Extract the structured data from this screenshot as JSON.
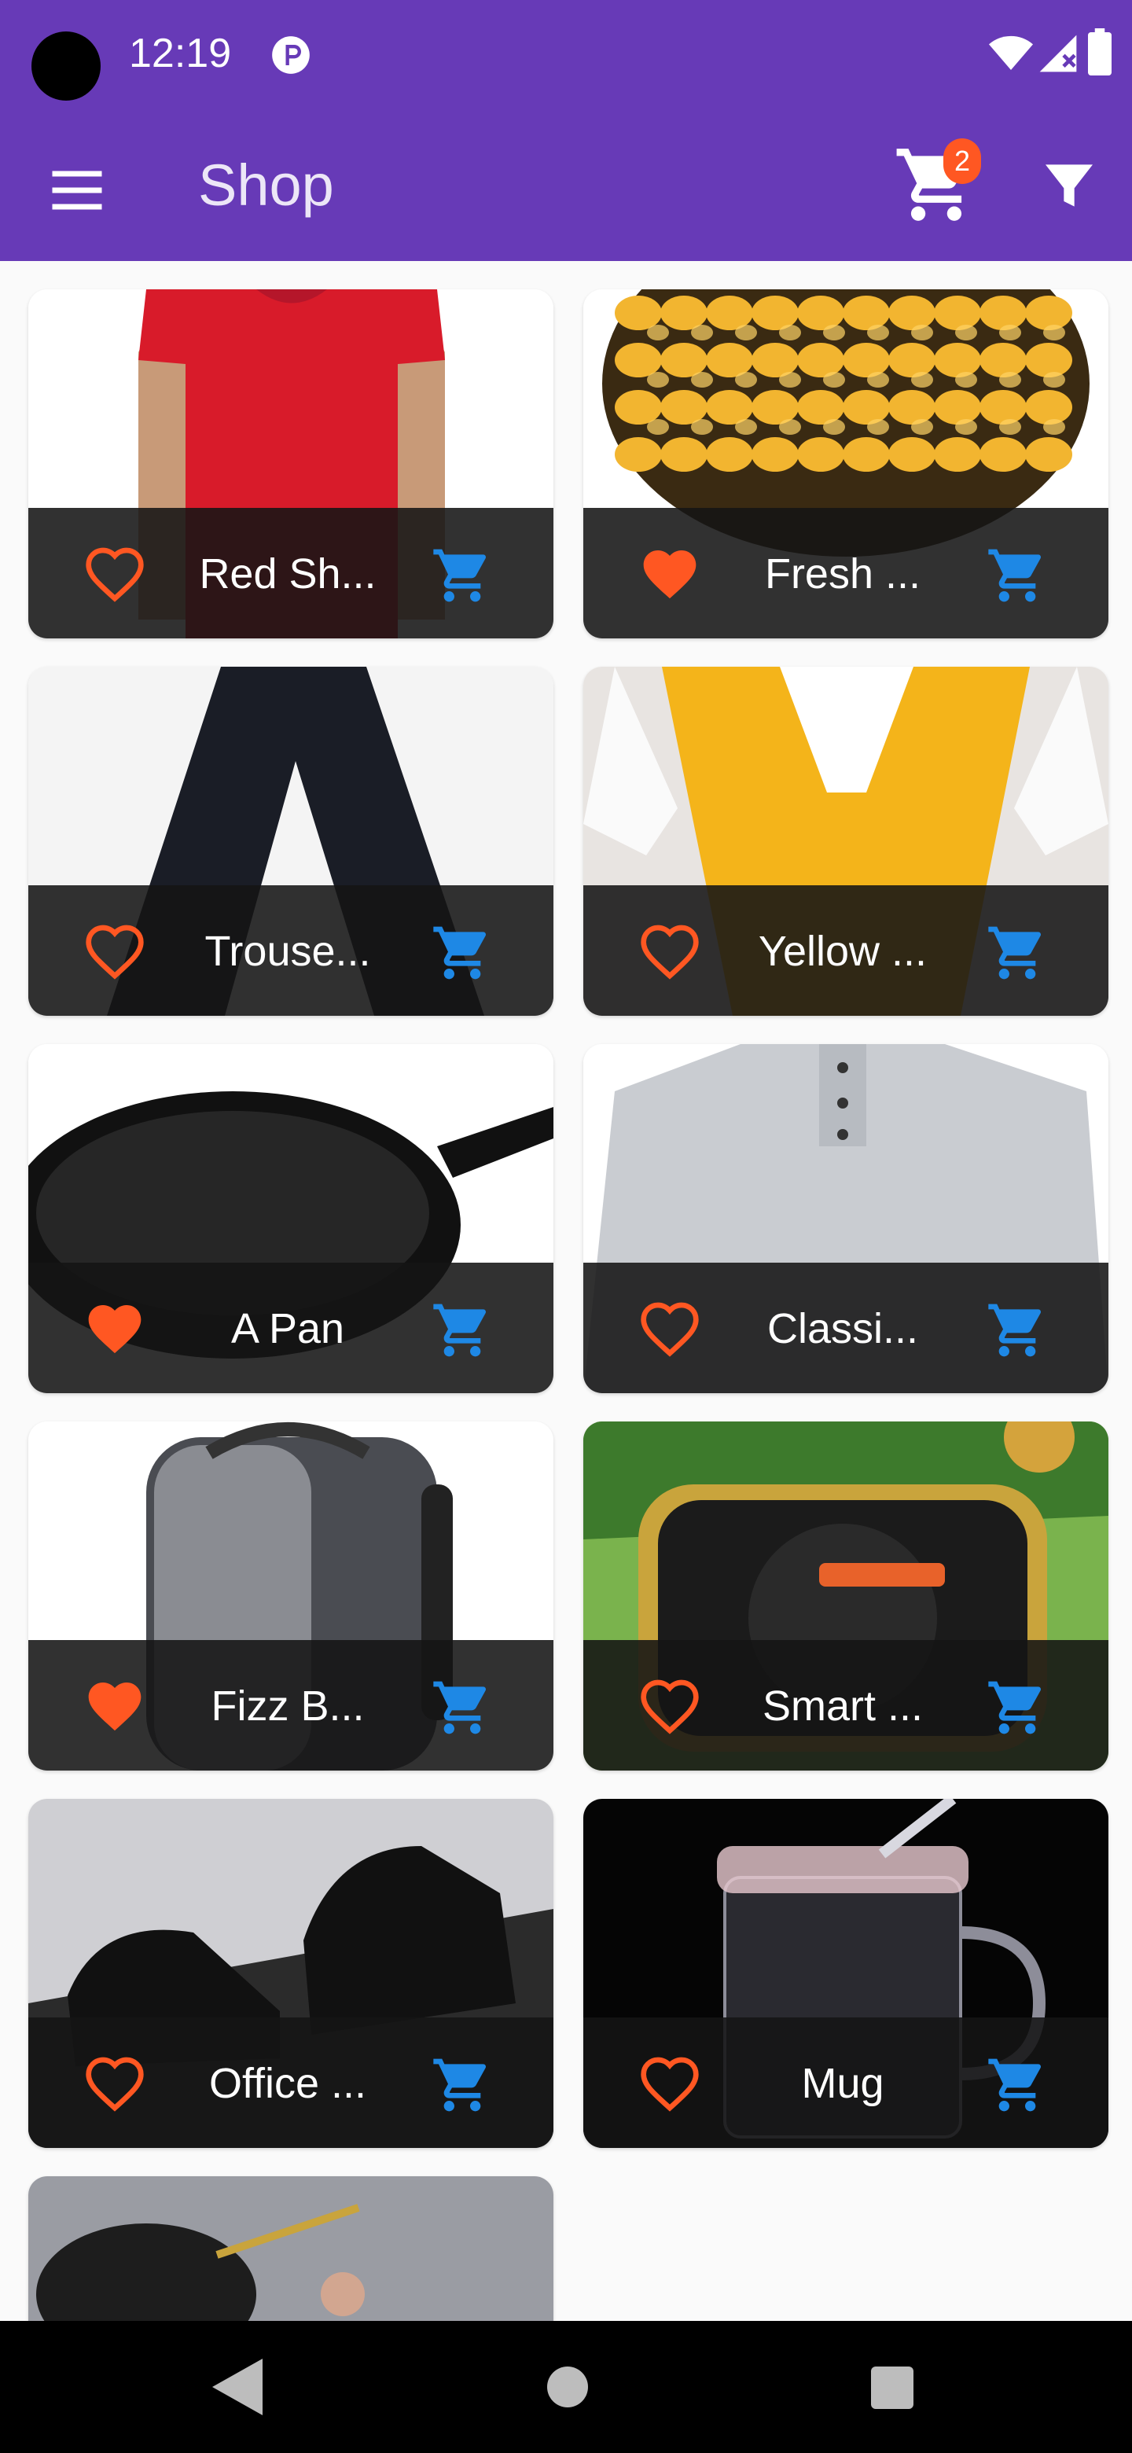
{
  "status_bar": {
    "time": "12:19"
  },
  "app_bar": {
    "title": "Shop",
    "cart_count": "2"
  },
  "colors": {
    "primary": "#673ab7",
    "accent": "#ff5722",
    "cart_icon": "#1e88e5"
  },
  "products": [
    {
      "name": "Red Sh...",
      "favorite": false,
      "image": "red-shirt"
    },
    {
      "name": "Fresh ...",
      "favorite": true,
      "image": "raisins"
    },
    {
      "name": "Trouse...",
      "favorite": false,
      "image": "trousers"
    },
    {
      "name": "Yellow ...",
      "favorite": false,
      "image": "yellow-scarf"
    },
    {
      "name": "A Pan",
      "favorite": true,
      "image": "pan"
    },
    {
      "name": "Classi...",
      "favorite": false,
      "image": "grey-shirt"
    },
    {
      "name": "Fizz B...",
      "favorite": true,
      "image": "backpack"
    },
    {
      "name": "Smart ...",
      "favorite": false,
      "image": "smart-watch"
    },
    {
      "name": "Office ...",
      "favorite": false,
      "image": "office-shoes"
    },
    {
      "name": "Mug",
      "favorite": false,
      "image": "mug"
    },
    {
      "name": "",
      "favorite": false,
      "image": "sunglasses"
    }
  ],
  "icons": {
    "menu": "menu-icon",
    "cart": "cart-icon",
    "filter": "filter-icon",
    "favorite": "heart-icon",
    "add_to_cart": "add-to-cart-icon"
  }
}
